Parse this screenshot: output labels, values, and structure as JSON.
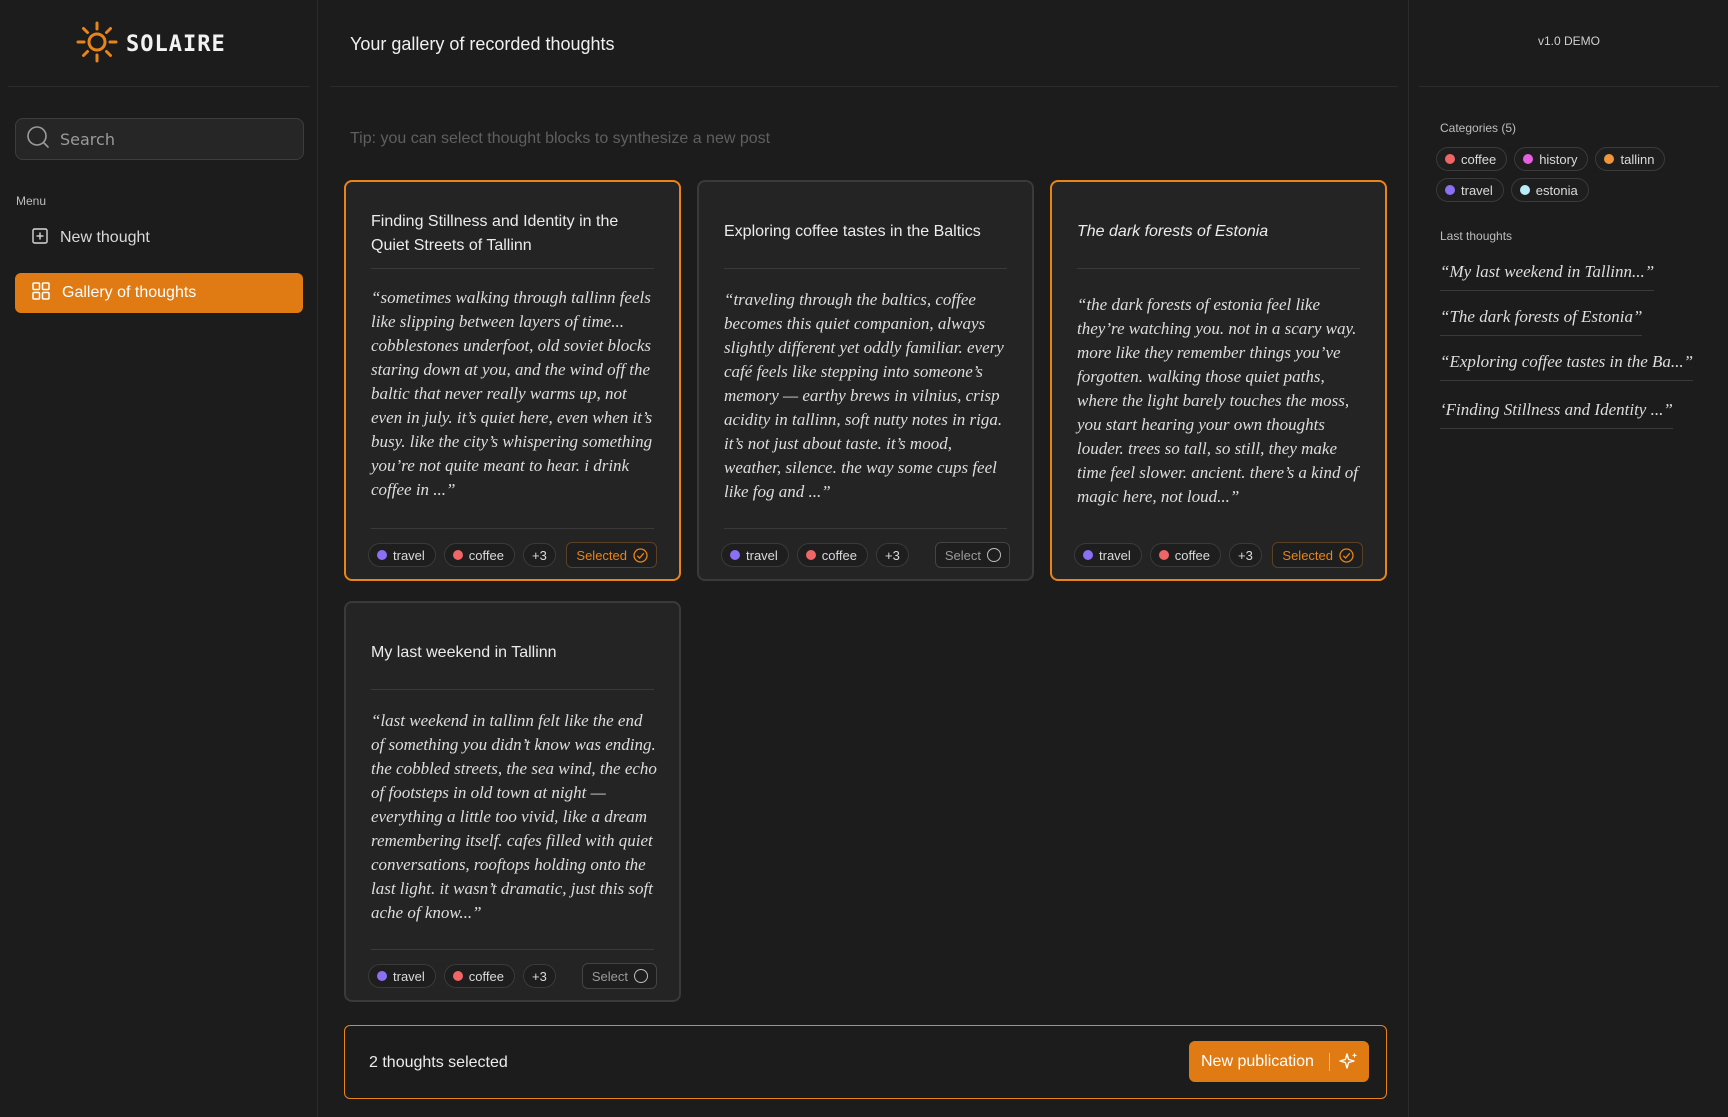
{
  "brand": {
    "name": "SOLAIRE"
  },
  "search": {
    "placeholder": "Search"
  },
  "menu": {
    "label": "Menu",
    "items": [
      {
        "label": "New thought",
        "icon": "plus-square-icon"
      },
      {
        "label": "Gallery of thoughts",
        "icon": "grid-icon",
        "active": true
      }
    ]
  },
  "header": {
    "title": "Your gallery of recorded thoughts",
    "tip": "Tip: you can select thought blocks to synthesize a new post"
  },
  "colors": {
    "accent": "#e07a12",
    "coffee": "#f06565",
    "history": "#e85ee0",
    "tallinn": "#f0963a",
    "travel": "#8b6ff5",
    "estonia": "#b8eef7"
  },
  "cards": [
    {
      "title": "Finding Stillness and Identity in the Quiet Streets of Tallinn",
      "body": "“sometimes walking through tallinn feels like slipping between layers of time... cobblestones underfoot, old soviet blocks staring down at you, and the wind off the baltic that never really warms up, not even in july. it’s quiet here, even when it’s busy. like the city’s whispering something you’re not quite meant to hear. i drink coffee in ...”",
      "tags": [
        "travel",
        "coffee"
      ],
      "more": "+3",
      "selected": true,
      "select_label": "Selected"
    },
    {
      "title": "Exploring coffee tastes in the Baltics",
      "body": "“traveling through the baltics, coffee becomes this quiet companion, always slightly different yet oddly familiar. every café feels like stepping into someone’s memory — earthy brews in vilnius, crisp acidity in tallinn, soft nutty notes in riga. it’s not just about taste. it’s mood, weather, silence. the way some cups feel like fog and ...”",
      "tags": [
        "travel",
        "coffee"
      ],
      "more": "+3",
      "selected": false,
      "select_label": "Select"
    },
    {
      "title": "The dark forests of Estonia",
      "body": "“the dark forests of estonia feel like they’re watching you. not in a scary way. more like they remember things you’ve forgotten. walking those quiet paths, where the light barely touches the moss, you start hearing your own thoughts louder. trees so tall, so still, they make time feel slower. ancient. there’s a kind of magic here, not loud...”",
      "tags": [
        "travel",
        "coffee"
      ],
      "more": "+3",
      "selected": true,
      "select_label": "Selected"
    },
    {
      "title": "My last weekend in Tallinn",
      "body": "“last weekend in tallinn felt like the end of something you didn’t know was ending. the cobbled streets, the sea wind, the echo of footsteps in old town at night — everything a little too vivid, like a dream remembering itself. cafes filled with quiet conversations, rooftops holding onto the last light. it wasn’t dramatic, just this soft ache of know...”",
      "tags": [
        "travel",
        "coffee"
      ],
      "more": "+3",
      "selected": false,
      "select_label": "Select"
    }
  ],
  "selection": {
    "count_text": "2 thoughts selected",
    "publish_label": "New publication"
  },
  "right": {
    "version": "v1.0 DEMO",
    "categories_label": "Categories (5)",
    "categories": [
      "coffee",
      "history",
      "tallinn",
      "travel",
      "estonia"
    ],
    "last_label": "Last thoughts",
    "last_thoughts": [
      "“My last weekend in Tallinn...”",
      "“The dark forests of Estonia”",
      "“Exploring coffee tastes in the Ba...”",
      "‘Finding Stillness and Identity ...”"
    ]
  }
}
